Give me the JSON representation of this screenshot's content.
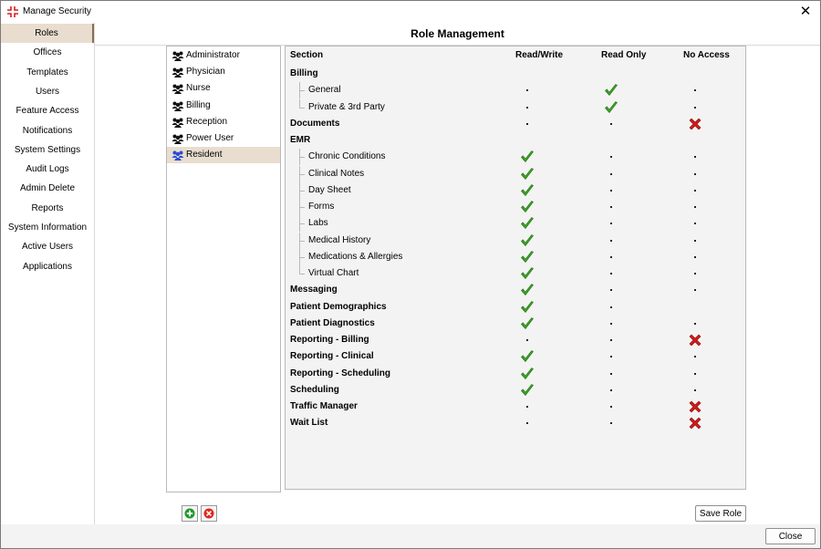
{
  "window": {
    "title": "Manage Security",
    "close_symbol": "✕"
  },
  "nav": {
    "items": [
      {
        "label": "Roles",
        "selected": true
      },
      {
        "label": "Offices"
      },
      {
        "label": "Templates"
      },
      {
        "label": "Users"
      },
      {
        "label": "Feature Access"
      },
      {
        "label": "Notifications"
      },
      {
        "label": "System Settings"
      },
      {
        "label": "Audit Logs"
      },
      {
        "label": "Admin Delete"
      },
      {
        "label": "Reports"
      },
      {
        "label": "System Information"
      },
      {
        "label": "Active Users"
      },
      {
        "label": "Applications"
      }
    ]
  },
  "main": {
    "title": "Role Management"
  },
  "roles": {
    "items": [
      {
        "label": "Administrator"
      },
      {
        "label": "Physician"
      },
      {
        "label": "Nurse"
      },
      {
        "label": "Billing"
      },
      {
        "label": "Reception"
      },
      {
        "label": "Power User"
      },
      {
        "label": "Resident",
        "selected": true
      }
    ],
    "icon": "users-group-icon",
    "add_icon": "add-circle-icon",
    "remove_icon": "remove-circle-icon"
  },
  "permissions": {
    "headers": {
      "section": "Section",
      "read_write": "Read/Write",
      "read_only": "Read Only",
      "no_access": "No Access"
    },
    "rows": [
      {
        "label": "Billing",
        "bold": true,
        "child": false,
        "rw": "",
        "ro": "",
        "na": ""
      },
      {
        "label": "General",
        "bold": false,
        "child": true,
        "rw": "dot",
        "ro": "check",
        "na": "dot"
      },
      {
        "label": "Private & 3rd Party",
        "bold": false,
        "child": true,
        "last_child": true,
        "rw": "dot",
        "ro": "check",
        "na": "dot"
      },
      {
        "label": "Documents",
        "bold": true,
        "child": false,
        "rw": "dot",
        "ro": "dot",
        "na": "cross"
      },
      {
        "label": "EMR",
        "bold": true,
        "child": false,
        "rw": "",
        "ro": "",
        "na": ""
      },
      {
        "label": "Chronic Conditions",
        "bold": false,
        "child": true,
        "rw": "check",
        "ro": "dot",
        "na": "dot"
      },
      {
        "label": "Clinical Notes",
        "bold": false,
        "child": true,
        "rw": "check",
        "ro": "dot",
        "na": "dot"
      },
      {
        "label": "Day Sheet",
        "bold": false,
        "child": true,
        "rw": "check",
        "ro": "dot",
        "na": "dot"
      },
      {
        "label": "Forms",
        "bold": false,
        "child": true,
        "rw": "check",
        "ro": "dot",
        "na": "dot"
      },
      {
        "label": "Labs",
        "bold": false,
        "child": true,
        "rw": "check",
        "ro": "dot",
        "na": "dot"
      },
      {
        "label": "Medical History",
        "bold": false,
        "child": true,
        "rw": "check",
        "ro": "dot",
        "na": "dot"
      },
      {
        "label": "Medications & Allergies",
        "bold": false,
        "child": true,
        "rw": "check",
        "ro": "dot",
        "na": "dot"
      },
      {
        "label": "Virtual Chart",
        "bold": false,
        "child": true,
        "last_child": true,
        "rw": "check",
        "ro": "dot",
        "na": "dot"
      },
      {
        "label": "Messaging",
        "bold": true,
        "child": false,
        "rw": "check",
        "ro": "dot",
        "na": "dot"
      },
      {
        "label": "Patient Demographics",
        "bold": true,
        "child": false,
        "rw": "check",
        "ro": "dot",
        "na": ""
      },
      {
        "label": "Patient Diagnostics",
        "bold": true,
        "child": false,
        "rw": "check",
        "ro": "dot",
        "na": "dot"
      },
      {
        "label": "Reporting - Billing",
        "bold": true,
        "child": false,
        "rw": "dot",
        "ro": "dot",
        "na": "cross"
      },
      {
        "label": "Reporting - Clinical",
        "bold": true,
        "child": false,
        "rw": "check",
        "ro": "dot",
        "na": "dot"
      },
      {
        "label": "Reporting - Scheduling",
        "bold": true,
        "child": false,
        "rw": "check",
        "ro": "dot",
        "na": "dot"
      },
      {
        "label": "Scheduling",
        "bold": true,
        "child": false,
        "rw": "check",
        "ro": "dot",
        "na": "dot"
      },
      {
        "label": "Traffic Manager",
        "bold": true,
        "child": false,
        "rw": "dot",
        "ro": "dot",
        "na": "cross"
      },
      {
        "label": "Wait List",
        "bold": true,
        "child": false,
        "rw": "dot",
        "ro": "dot",
        "na": "cross"
      }
    ]
  },
  "buttons": {
    "save_role": "Save Role",
    "close": "Close"
  },
  "colors": {
    "selection": "#e8ddcf",
    "check": "#3aa324",
    "cross": "#d11a1a",
    "add": "#1f9a2a",
    "remove": "#e0281f"
  }
}
